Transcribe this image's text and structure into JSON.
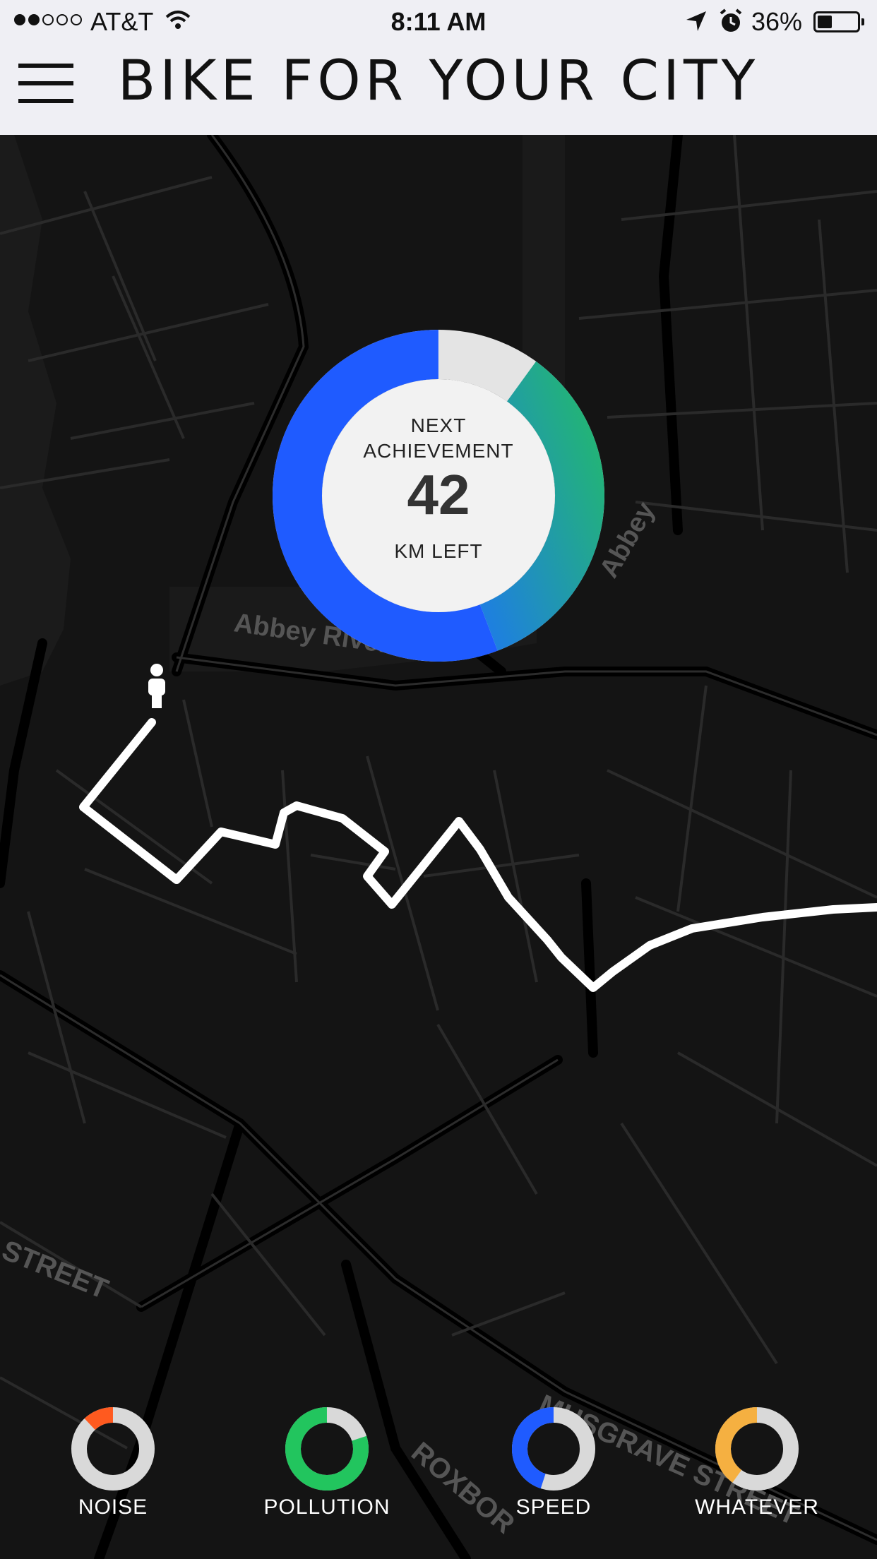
{
  "status_bar": {
    "carrier": "AT&T",
    "time": "8:11 AM",
    "battery": "36%",
    "battery_level": 0.36,
    "signal_bars_filled": 2,
    "signal_bars_total": 5
  },
  "header": {
    "title": "BIKE FOR YOUR CITY",
    "menu_icon": "hamburger-menu-icon"
  },
  "map": {
    "labels": [
      "Abbey River",
      "Abbey",
      "STREET",
      "ROXBOR",
      "MUSGRAVE STREET"
    ],
    "marker_icon": "person-icon",
    "route_color": "#ffffff"
  },
  "achievement": {
    "line1": "NEXT",
    "line2": "ACHIEVEMENT",
    "value": "42",
    "line3": "KM LEFT",
    "progress_fraction": 0.9,
    "colors": {
      "blue": "#1f5bff",
      "green": "#23b574",
      "track": "#e4e4e4",
      "center": "#f2f2f2"
    }
  },
  "gauges": [
    {
      "label": "NOISE",
      "fraction": 0.12,
      "color": "#ff5a1f"
    },
    {
      "label": "POLLUTION",
      "fraction": 0.8,
      "color": "#22c55e"
    },
    {
      "label": "SPEED",
      "fraction": 0.45,
      "color": "#1f5bff"
    },
    {
      "label": "WHATEVER",
      "fraction": 0.4,
      "color": "#f5b041"
    }
  ]
}
